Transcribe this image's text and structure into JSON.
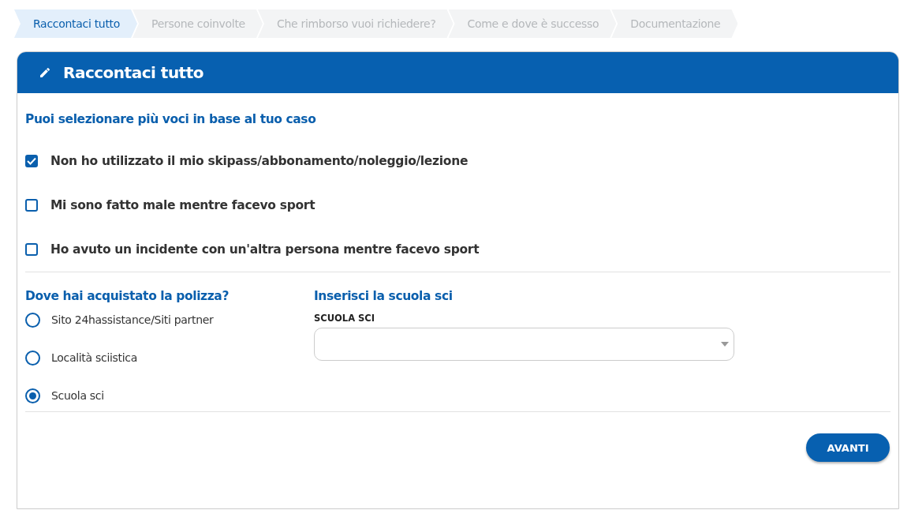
{
  "steps": [
    {
      "label": "Raccontaci tutto",
      "selected": true
    },
    {
      "label": "Persone coinvolte",
      "selected": false
    },
    {
      "label": "Che rimborso vuoi richiedere?",
      "selected": false
    },
    {
      "label": "Come e dove è successo",
      "selected": false
    },
    {
      "label": "Documentazione",
      "selected": false
    }
  ],
  "card": {
    "title": "Raccontaci tutto"
  },
  "situations": {
    "heading": "Puoi selezionare più voci in base al tuo caso",
    "items": [
      {
        "label": "Non ho utilizzato il mio skipass/abbonamento/noleggio/lezione",
        "checked": true
      },
      {
        "label": "Mi sono fatto male mentre facevo sport",
        "checked": false
      },
      {
        "label": "Ho avuto un incidente con un'altra persona mentre facevo sport",
        "checked": false
      }
    ]
  },
  "purchase": {
    "heading": "Dove hai acquistato la polizza?",
    "options": [
      {
        "label": "Sito 24hassistance/Siti partner",
        "selected": false
      },
      {
        "label": "Località sciistica",
        "selected": false
      },
      {
        "label": "Scuola sci",
        "selected": true
      }
    ]
  },
  "school": {
    "heading": "Inserisci la scuola sci",
    "field_label": "SCUOLA SCI"
  },
  "next_button": "AVANTI"
}
